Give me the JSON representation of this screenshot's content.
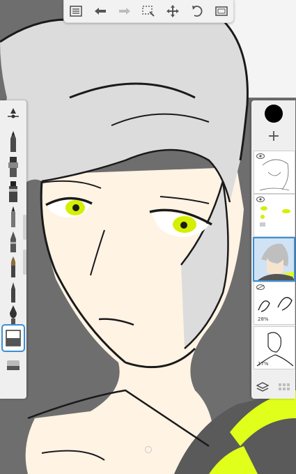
{
  "app": {
    "top_toolbar": {
      "icons": [
        "list-icon",
        "undo-icon",
        "redo-icon",
        "select-icon",
        "move-icon",
        "rotate-icon",
        "canvas-icon"
      ]
    },
    "brush_tools": {
      "icons": [
        "brush-size-icon",
        "pencil-icon",
        "airbrush-icon",
        "marker-icon",
        "ink-pen-icon",
        "fineliner-icon",
        "paintbrush-icon",
        "smudge-icon",
        "calligraphy-pen-icon",
        "fill-icon",
        "eraser-icon"
      ],
      "selected_index": 9
    },
    "layers_panel": {
      "current_color": "#000000",
      "add_label": "+",
      "layers": [
        {
          "name": "sketch-layer",
          "opacity_label": ""
        },
        {
          "name": "eyes-layer",
          "opacity_label": ""
        },
        {
          "name": "color-layer",
          "opacity_label": ""
        },
        {
          "name": "hands-layer",
          "opacity_label": "28%"
        },
        {
          "name": "body-sketch-layer",
          "opacity_label": "17%"
        }
      ],
      "selected_layer_index": 2
    },
    "colors": {
      "accent": "#3b8fd6",
      "hair": "#d9d9d9",
      "skin": "#fff3e4",
      "eyes": "#d4ef00",
      "jacket_green": "#e0ff1a",
      "background": "#6e6e6e"
    }
  }
}
